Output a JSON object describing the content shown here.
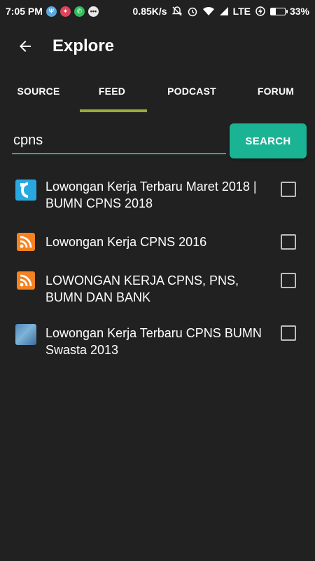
{
  "status_bar": {
    "time": "7:05 PM",
    "speed": "0.85K/s",
    "network": "LTE",
    "battery_percent": "33%",
    "battery_level": 0.33,
    "notification_icons": [
      "psiphon-icon",
      "game-icon",
      "whatsapp-icon",
      "more-dots-icon"
    ]
  },
  "app_bar": {
    "title": "Explore",
    "back_icon": "arrow-back-icon"
  },
  "tabs": [
    {
      "label": "SOURCE",
      "selected": false
    },
    {
      "label": "FEED",
      "selected": true
    },
    {
      "label": "PODCAST",
      "selected": false
    },
    {
      "label": "FORUM",
      "selected": false
    }
  ],
  "search": {
    "value": "cpns",
    "button_label": "SEARCH"
  },
  "results": [
    {
      "title": "Lowongan Kerja Terbaru Maret 2018 | BUMN CPNS 2018",
      "icon": "site-logo-icon",
      "checked": false
    },
    {
      "title": "Lowongan Kerja CPNS 2016",
      "icon": "rss-icon",
      "checked": false
    },
    {
      "title": "LOWONGAN KERJA CPNS, PNS, BUMN DAN BANK",
      "icon": "rss-icon",
      "checked": false
    },
    {
      "title": "Lowongan Kerja Terbaru CPNS BUMN Swasta 2013",
      "icon": "site-thumbnail-icon",
      "checked": false
    }
  ],
  "colors": {
    "background": "#212121",
    "accent": "#1ab394",
    "tab_indicator": "#9bab38",
    "rss": "#f58220"
  }
}
